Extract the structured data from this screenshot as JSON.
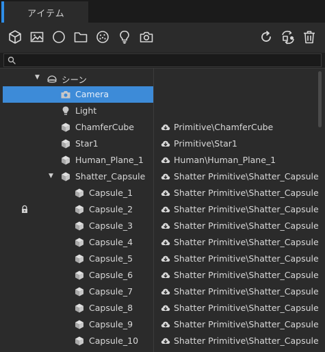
{
  "tab": {
    "label": "アイテム"
  },
  "toolbar": {
    "left": [
      {
        "name": "cube-icon"
      },
      {
        "name": "image-icon"
      },
      {
        "name": "circle-icon"
      },
      {
        "name": "folder-icon"
      },
      {
        "name": "particles-icon"
      },
      {
        "name": "lightbulb-icon"
      },
      {
        "name": "camera-icon"
      }
    ],
    "right": [
      {
        "name": "refresh-icon"
      },
      {
        "name": "sync-icon"
      },
      {
        "name": "trash-icon"
      }
    ]
  },
  "search": {
    "placeholder": "",
    "value": ""
  },
  "tree": [
    {
      "label": "シーン",
      "icon": "scene-icon",
      "indent": 0,
      "expanded": true,
      "selected": false,
      "locked": false,
      "source": ""
    },
    {
      "label": "Camera",
      "icon": "camera-icon",
      "indent": 1,
      "expanded": null,
      "selected": true,
      "locked": false,
      "source": ""
    },
    {
      "label": "Light",
      "icon": "lightbulb-icon",
      "indent": 1,
      "expanded": null,
      "selected": false,
      "locked": false,
      "source": ""
    },
    {
      "label": "ChamferCube",
      "icon": "cube-icon",
      "indent": 1,
      "expanded": null,
      "selected": false,
      "locked": false,
      "source": "Primitive\\ChamferCube"
    },
    {
      "label": "Star1",
      "icon": "cube-icon",
      "indent": 1,
      "expanded": null,
      "selected": false,
      "locked": false,
      "source": "Primitive\\Star1"
    },
    {
      "label": "Human_Plane_1",
      "icon": "cube-icon",
      "indent": 1,
      "expanded": null,
      "selected": false,
      "locked": false,
      "source": "Human\\Human_Plane_1"
    },
    {
      "label": "Shatter_Capsule",
      "icon": "cube-icon",
      "indent": 1,
      "expanded": true,
      "selected": false,
      "locked": false,
      "source": "Shatter Primitive\\Shatter_Capsule"
    },
    {
      "label": "Capsule_1",
      "icon": "cube-icon",
      "indent": 2,
      "expanded": null,
      "selected": false,
      "locked": false,
      "source": "Shatter Primitive\\Shatter_Capsule"
    },
    {
      "label": "Capsule_2",
      "icon": "cube-icon",
      "indent": 2,
      "expanded": null,
      "selected": false,
      "locked": true,
      "source": "Shatter Primitive\\Shatter_Capsule"
    },
    {
      "label": "Capsule_3",
      "icon": "cube-icon",
      "indent": 2,
      "expanded": null,
      "selected": false,
      "locked": false,
      "source": "Shatter Primitive\\Shatter_Capsule"
    },
    {
      "label": "Capsule_4",
      "icon": "cube-icon",
      "indent": 2,
      "expanded": null,
      "selected": false,
      "locked": false,
      "source": "Shatter Primitive\\Shatter_Capsule"
    },
    {
      "label": "Capsule_5",
      "icon": "cube-icon",
      "indent": 2,
      "expanded": null,
      "selected": false,
      "locked": false,
      "source": "Shatter Primitive\\Shatter_Capsule"
    },
    {
      "label": "Capsule_6",
      "icon": "cube-icon",
      "indent": 2,
      "expanded": null,
      "selected": false,
      "locked": false,
      "source": "Shatter Primitive\\Shatter_Capsule"
    },
    {
      "label": "Capsule_7",
      "icon": "cube-icon",
      "indent": 2,
      "expanded": null,
      "selected": false,
      "locked": false,
      "source": "Shatter Primitive\\Shatter_Capsule"
    },
    {
      "label": "Capsule_8",
      "icon": "cube-icon",
      "indent": 2,
      "expanded": null,
      "selected": false,
      "locked": false,
      "source": "Shatter Primitive\\Shatter_Capsule"
    },
    {
      "label": "Capsule_9",
      "icon": "cube-icon",
      "indent": 2,
      "expanded": null,
      "selected": false,
      "locked": false,
      "source": "Shatter Primitive\\Shatter_Capsule"
    },
    {
      "label": "Capsule_10",
      "icon": "cube-icon",
      "indent": 2,
      "expanded": null,
      "selected": false,
      "locked": false,
      "source": "Shatter Primitive\\Shatter_Capsule"
    }
  ],
  "colors": {
    "accent": "#2f8ee8",
    "selection": "#3d8bd8",
    "panel": "#2b2b2b",
    "text": "#d8d8d8"
  }
}
